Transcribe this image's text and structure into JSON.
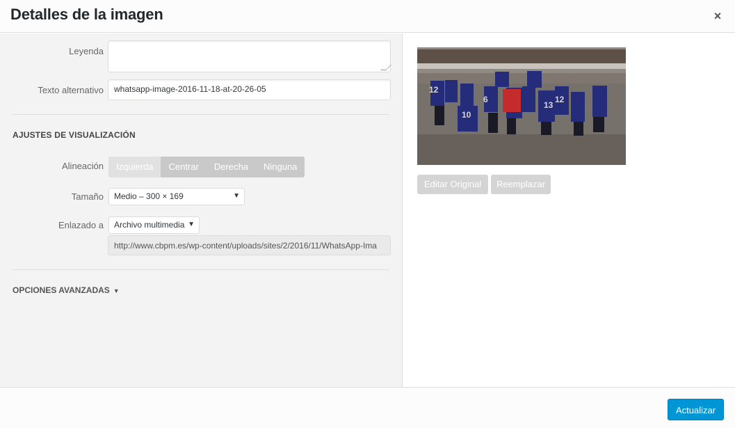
{
  "header": {
    "title": "Detalles de la imagen",
    "close_icon": "×"
  },
  "form": {
    "caption_label": "Leyenda",
    "caption_value": "",
    "alt_label": "Texto alternativo",
    "alt_value": "whatsapp-image-2016-11-18-at-20-26-05"
  },
  "display_settings": {
    "title": "AJUSTES DE VISUALIZACIÓN",
    "alignment_label": "Alineación",
    "alignment_options": [
      "Izquierda",
      "Centrar",
      "Derecha",
      "Ninguna"
    ],
    "alignment_selected": "Izquierda",
    "size_label": "Tamaño",
    "size_value": "Medio – 300 × 169",
    "link_label": "Enlazado a",
    "link_value": "Archivo multimedia",
    "link_url": "http://www.cbpm.es/wp-content/uploads/sites/2/2016/11/WhatsApp-Ima"
  },
  "advanced": {
    "label": "OPCIONES AVANZADAS"
  },
  "preview": {
    "edit_original": "Editar Original",
    "replace": "Reemplazar"
  },
  "footer": {
    "update_label": "Actualizar"
  },
  "colors": {
    "primary": "#0095d4",
    "panel_bg": "#f3f3f3",
    "disabled_button": "#d4d4d4"
  }
}
